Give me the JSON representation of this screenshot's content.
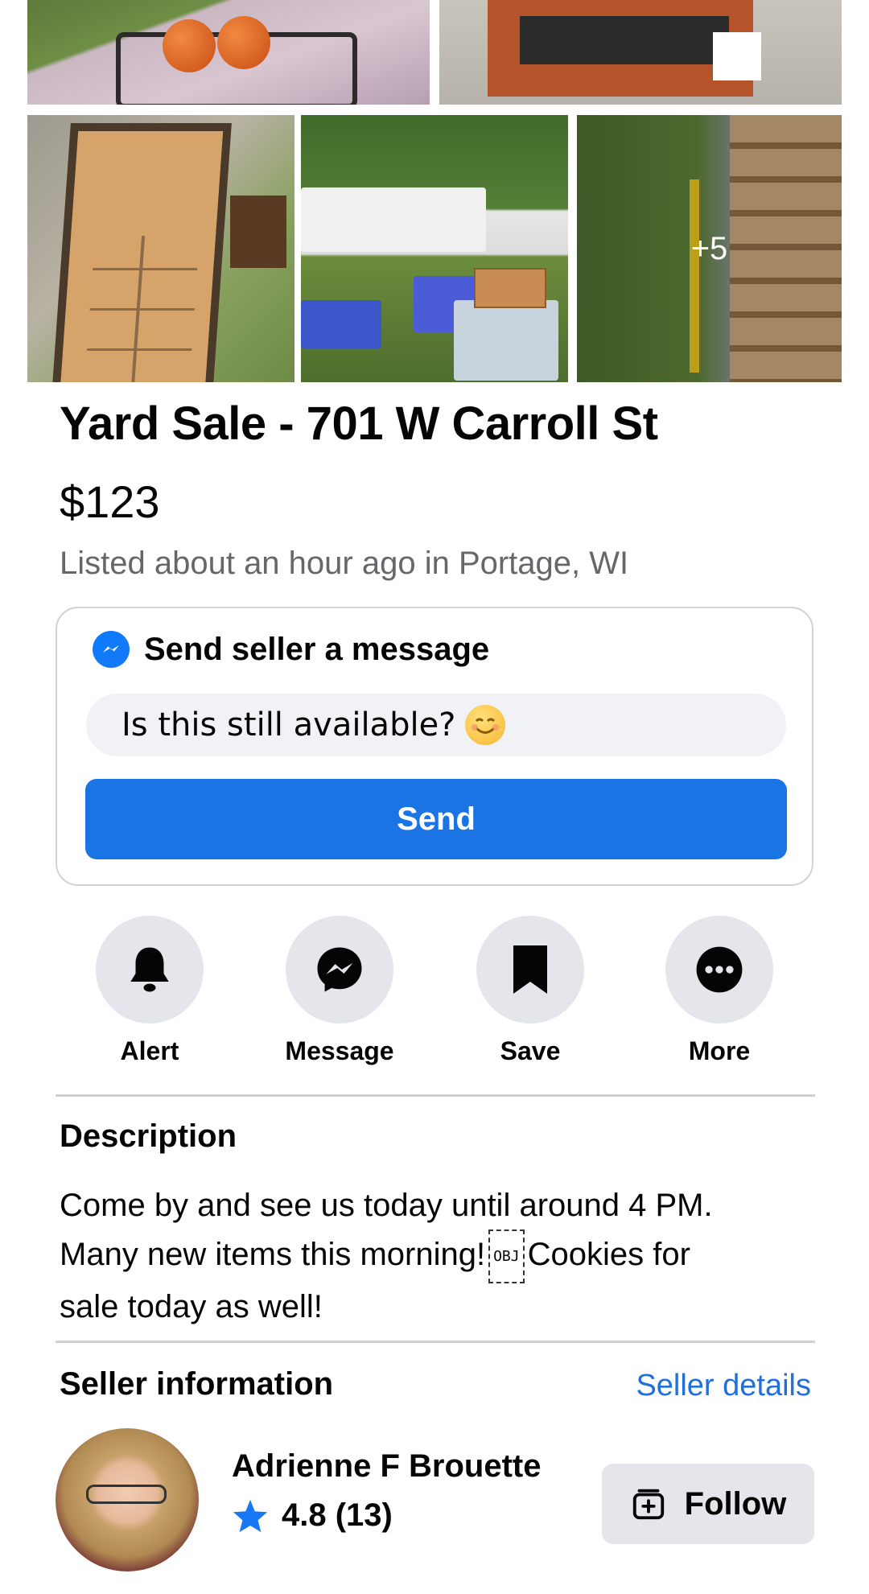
{
  "gallery": {
    "more_count": "+5"
  },
  "listing": {
    "title": "Yard Sale - 701 W Carroll St",
    "price": "$123",
    "listed_info": "Listed about an hour ago in Portage, WI"
  },
  "message_card": {
    "heading": "Send seller a message",
    "input_value": "Is this still available?",
    "send_label": "Send"
  },
  "actions": [
    {
      "label": "Alert",
      "icon": "bell-icon"
    },
    {
      "label": "Message",
      "icon": "messenger-icon"
    },
    {
      "label": "Save",
      "icon": "bookmark-icon"
    },
    {
      "label": "More",
      "icon": "more-icon"
    }
  ],
  "description": {
    "heading": "Description",
    "line1": "Come by and see us today until around 4 PM.",
    "line2a": "Many new items this morning!",
    "obj_glyph": "OBJ",
    "line2b": "Cookies for",
    "line3": "sale today as well!"
  },
  "seller": {
    "heading": "Seller information",
    "details_link": "Seller details",
    "name": "Adrienne F Brouette",
    "rating": "4.8 (13)",
    "follow_label": "Follow"
  },
  "colors": {
    "accent": "#1b74e4",
    "link": "#216fdb",
    "secondary_text": "#65676b",
    "button_bg": "#e4e6eb"
  }
}
